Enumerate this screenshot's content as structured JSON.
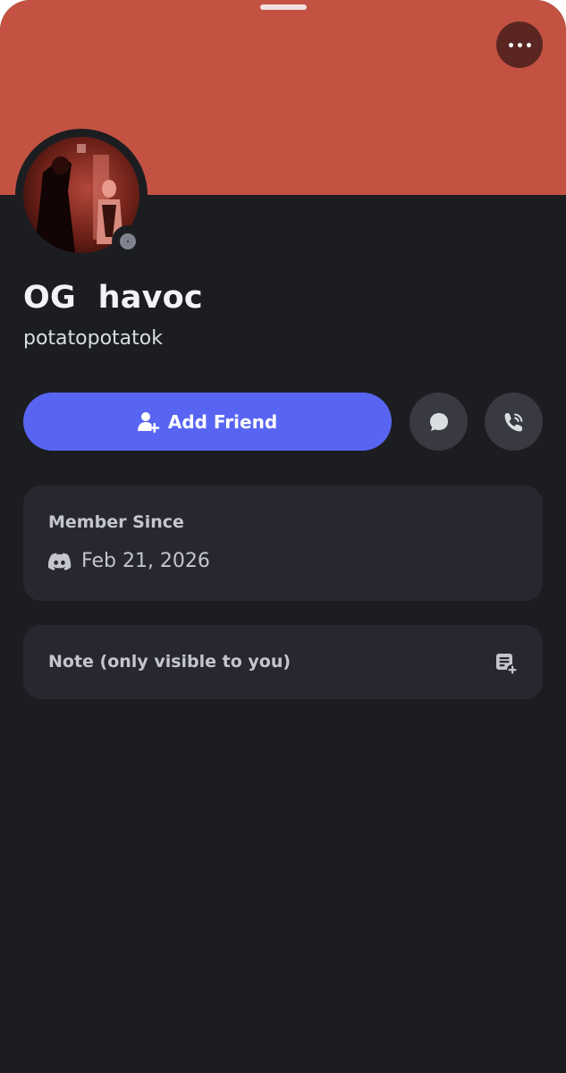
{
  "profile": {
    "display_name": "OG  havoc",
    "username": "potatopotatok",
    "banner_color": "#c45243",
    "status": "offline"
  },
  "actions": {
    "add_friend_label": "Add Friend",
    "message_icon": "chat-bubble-icon",
    "call_icon": "phone-call-icon",
    "more_icon": "more-horizontal-icon",
    "accent_color": "#5865f2"
  },
  "member_since": {
    "title": "Member Since",
    "icon": "discord-logo-icon",
    "date": "Feb 21, 2026"
  },
  "note": {
    "label": "Note (only visible to you)",
    "icon": "note-add-icon"
  }
}
